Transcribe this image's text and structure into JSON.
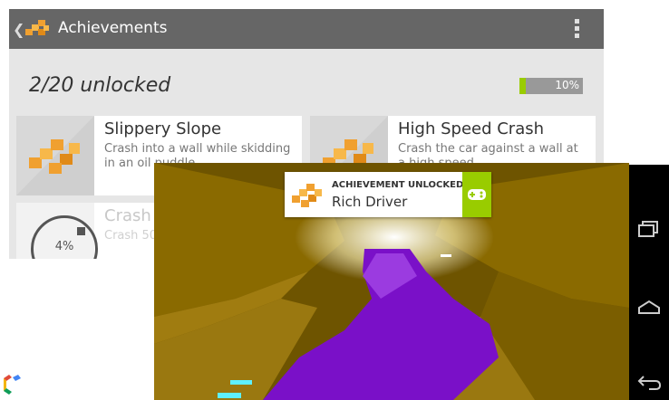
{
  "app": {
    "title": "Achievements",
    "back_icon": "chevron-left-icon",
    "logo_icon": "cube-cluster-logo-icon",
    "menu_icon": "overflow-menu-icon"
  },
  "summary": {
    "unlocked_text": "2/20 unlocked",
    "progress_label": "10%",
    "progress_value": 0.1
  },
  "achievements": [
    {
      "title": "Slippery Slope",
      "description": "Crash into a wall while skidding in an oil puddle",
      "state": "unlocked",
      "icon": "cube-cluster-icon"
    },
    {
      "title": "High Speed Crash",
      "description": "Crash the car against a wall at a high speed",
      "state": "unlocked",
      "icon": "cube-cluster-icon"
    },
    {
      "title": "Crash",
      "description": "Crash 50",
      "state": "locked",
      "progress_label": "4%",
      "progress_value": 0.04,
      "icon": "progress-ring-icon"
    }
  ],
  "toast": {
    "header": "ACHIEVEMENT UNLOCKED",
    "name": "Rich Driver",
    "badge_icon": "gamepad-icon"
  },
  "navbar": {
    "buttons": [
      "recent-apps-icon",
      "home-icon",
      "back-icon"
    ]
  },
  "colors": {
    "accent": "#99cc00",
    "action_bar": "#666666",
    "tile_orange": "#f0a030",
    "road_purple": "#7a10c8",
    "wall_gold": "#8a6a00"
  }
}
